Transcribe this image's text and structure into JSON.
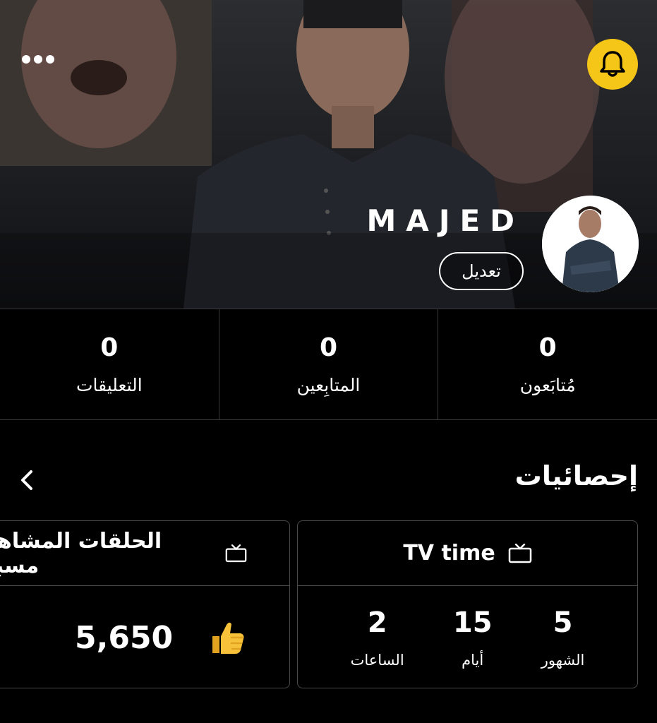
{
  "header": {
    "username": "MAJED",
    "edit_label": "تعديل",
    "more_icon": "more-dots-icon",
    "bell_icon": "bell-icon",
    "accent_color": "#f5c518"
  },
  "counts": [
    {
      "value": "0",
      "label": "التعليقات"
    },
    {
      "value": "0",
      "label": "المتابِعين"
    },
    {
      "value": "0",
      "label": "مُتابَعون"
    }
  ],
  "stats": {
    "title": "إحصائيات",
    "tv_time": {
      "title": "TV time",
      "items": [
        {
          "value": "2",
          "label": "الساعات"
        },
        {
          "value": "15",
          "label": "أيام"
        },
        {
          "value": "5",
          "label": "الشهور"
        }
      ]
    },
    "episodes": {
      "title": "الحلقات المشاهدة مسبقًا",
      "value": "5,650",
      "icon": "thumbs-up-icon"
    }
  }
}
